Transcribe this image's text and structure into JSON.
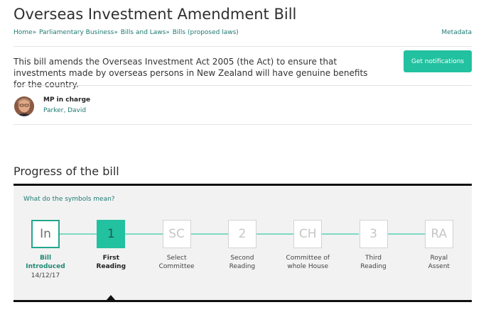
{
  "page": {
    "title": "Overseas Investment Amendment Bill",
    "metadata_link": "Metadata"
  },
  "breadcrumb": [
    {
      "label": "Home"
    },
    {
      "label": "Parliamentary Business"
    },
    {
      "label": "Bills and Laws"
    },
    {
      "label": "Bills (proposed laws)"
    }
  ],
  "breadcrumb_separator": "»",
  "summary": {
    "description": "This bill amends the Overseas Investment Act 2005 (the Act) to ensure that investments made by overseas persons in New Zealand will have genuine benefits for the country.",
    "notify_button": "Get notifications"
  },
  "mp": {
    "label": "MP in charge",
    "name": "Parker, David"
  },
  "progress": {
    "title": "Progress of the bill",
    "symbols_link": "What do the symbols mean?",
    "stages": [
      {
        "symbol": "In",
        "label_line1": "Bill",
        "label_line2": "Introduced",
        "date": "14/12/17",
        "state": "done"
      },
      {
        "symbol": "1",
        "label_line1": "First",
        "label_line2": "Reading",
        "date": "",
        "state": "active"
      },
      {
        "symbol": "SC",
        "label_line1": "Select",
        "label_line2": "Committee",
        "date": "",
        "state": "pending"
      },
      {
        "symbol": "2",
        "label_line1": "Second",
        "label_line2": "Reading",
        "date": "",
        "state": "pending"
      },
      {
        "symbol": "CH",
        "label_line1": "Committee of",
        "label_line2": "whole House",
        "date": "",
        "state": "pending"
      },
      {
        "symbol": "3",
        "label_line1": "Third",
        "label_line2": "Reading",
        "date": "",
        "state": "pending"
      },
      {
        "symbol": "RA",
        "label_line1": "Royal",
        "label_line2": "Assent",
        "date": "",
        "state": "pending"
      }
    ]
  },
  "colors": {
    "accent": "#22c1a0",
    "link": "#1f7a73",
    "connector": "#7fd9c4"
  }
}
